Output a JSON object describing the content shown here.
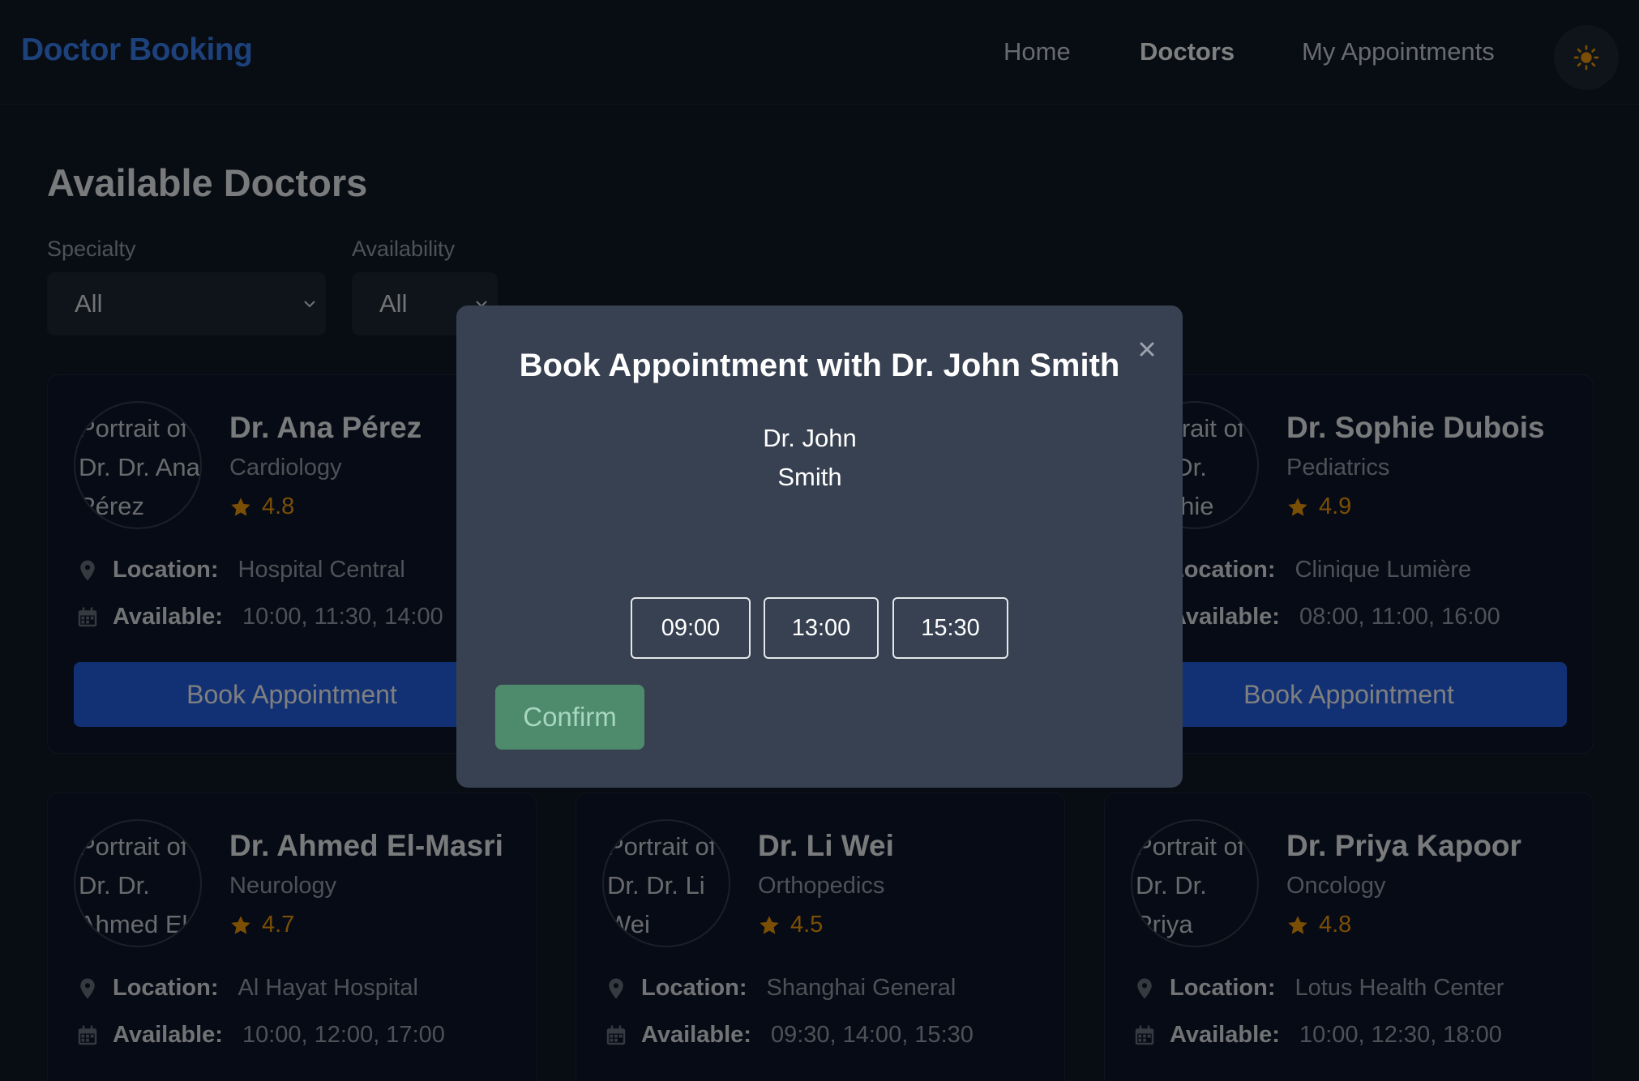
{
  "navbar": {
    "brand": "Doctor Booking",
    "links": [
      "Home",
      "Doctors",
      "My Appointments"
    ],
    "active": "Doctors",
    "theme_icon": "sun-icon"
  },
  "main": {
    "title": "Available Doctors",
    "filters": {
      "specialty_label": "Specialty",
      "specialty_value": "All",
      "availability_label": "Availability",
      "availability_value": "All"
    },
    "location_label": "Location:",
    "available_label": "Available:",
    "book_label": "Book Appointment",
    "doctors": [
      {
        "avatar_alt": "Portrait of Dr. Dr. Ana Pérez",
        "name": "Dr. Ana Pérez",
        "specialty": "Cardiology",
        "rating": "4.8",
        "location": "Hospital Central",
        "available": "10:00, 11:30, 14:00"
      },
      {
        "avatar_alt": "Portrait of Dr. Dr. Sophie Dubois",
        "name": "Dr. Sophie Dubois",
        "specialty": "Pediatrics",
        "rating": "4.9",
        "location": "Clinique Lumière",
        "available": "08:00, 11:00, 16:00"
      },
      {
        "avatar_alt": "Portrait of Dr. Dr. Ahmed El-Masri",
        "name": "Dr. Ahmed El-Masri",
        "specialty": "Neurology",
        "rating": "4.7",
        "location": "Al Hayat Hospital",
        "available": "10:00, 12:00, 17:00"
      },
      {
        "avatar_alt": "Portrait of Dr. Dr. Li Wei",
        "name": "Dr. Li Wei",
        "specialty": "Orthopedics",
        "rating": "4.5",
        "location": "Shanghai General",
        "available": "09:30, 14:00, 15:30"
      },
      {
        "avatar_alt": "Portrait of Dr. Dr. Priya Kapoor",
        "name": "Dr. Priya Kapoor",
        "specialty": "Oncology",
        "rating": "4.8",
        "location": "Lotus Health Center",
        "available": "10:00, 12:30, 18:00"
      }
    ]
  },
  "modal": {
    "title": "Book Appointment with Dr. John Smith",
    "image_alt": "Dr. John Smith",
    "slots": [
      "09:00",
      "13:00",
      "15:30"
    ],
    "confirm_label": "Confirm",
    "close_icon": "close-icon"
  },
  "colors": {
    "brand": "#3b82f6",
    "primary_button": "#2563eb",
    "confirm_button": "#4e8a6c",
    "rating": "#f59e0b",
    "background": "#111827"
  }
}
